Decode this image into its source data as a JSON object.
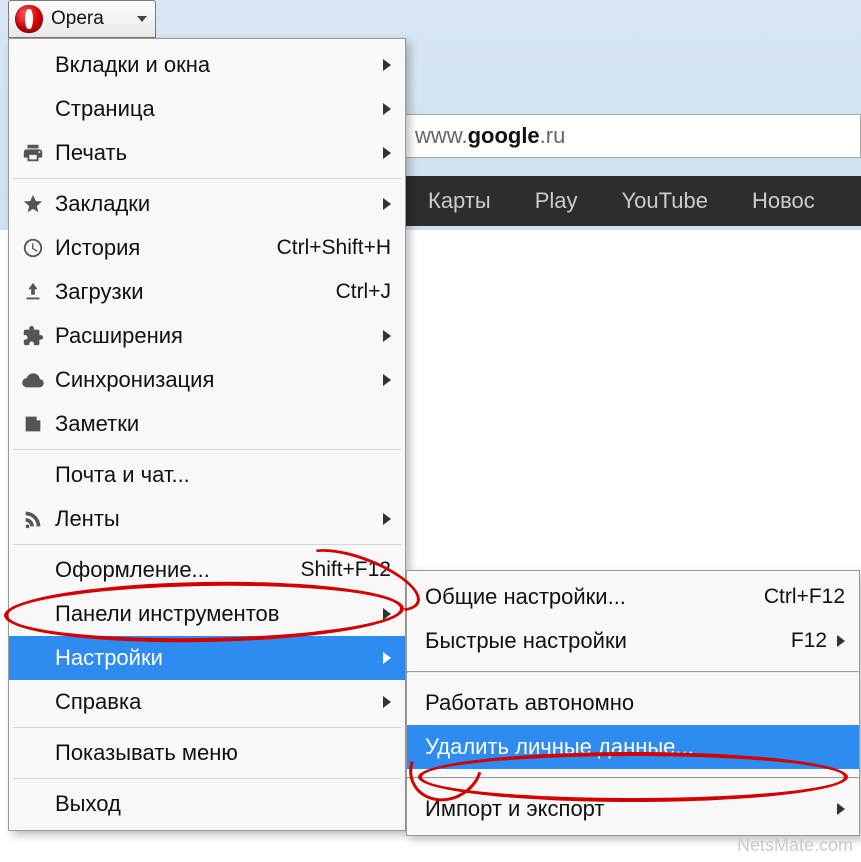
{
  "app": {
    "name": "Opera"
  },
  "address": {
    "prefix": "www.",
    "host": "google",
    "suffix": ".ru"
  },
  "nav": {
    "maps": "Карты",
    "play": "Play",
    "youtube": "YouTube",
    "news": "Новос"
  },
  "menu": {
    "tabs": "Вкладки и окна",
    "page": "Страница",
    "print": "Печать",
    "bookmarks": "Закладки",
    "history": "История",
    "history_sc": "Ctrl+Shift+H",
    "downloads": "Загрузки",
    "downloads_sc": "Ctrl+J",
    "extensions": "Расширения",
    "sync": "Синхронизация",
    "notes": "Заметки",
    "mail": "Почта и чат...",
    "feeds": "Ленты",
    "themes": "Оформление...",
    "themes_sc": "Shift+F12",
    "toolbars": "Панели инструментов",
    "settings": "Настройки",
    "help": "Справка",
    "showmenu": "Показывать меню",
    "exit": "Выход"
  },
  "submenu": {
    "general": "Общие настройки...",
    "general_sc": "Ctrl+F12",
    "quick": "Быстрые настройки",
    "quick_sc": "F12",
    "offline": "Работать автономно",
    "delete": "Удалить личные данные...",
    "import": "Импорт и экспорт"
  },
  "watermark": "NetsMate.com"
}
